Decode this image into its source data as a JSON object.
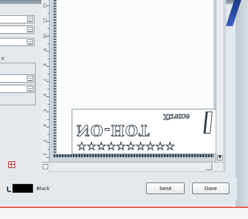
{
  "left_panel": {
    "partial_label": "e"
  },
  "ruler": {
    "labels": [
      "12",
      "11",
      "10",
      "9",
      "8",
      "7",
      "6",
      "5",
      "4",
      "3",
      "2",
      "1"
    ]
  },
  "design": {
    "small_word": "Xtreme",
    "big_word": "NO-HOT",
    "stars": "☆☆☆☆☆☆☆☆☆☆"
  },
  "bottom_bar": {
    "color_name": "Black",
    "color_hex": "#000000",
    "send_label": "Send",
    "done_label": "Done"
  },
  "icons": [
    "color-picker-icon",
    "grid-icon",
    "scroll-down-arrow-icon"
  ]
}
